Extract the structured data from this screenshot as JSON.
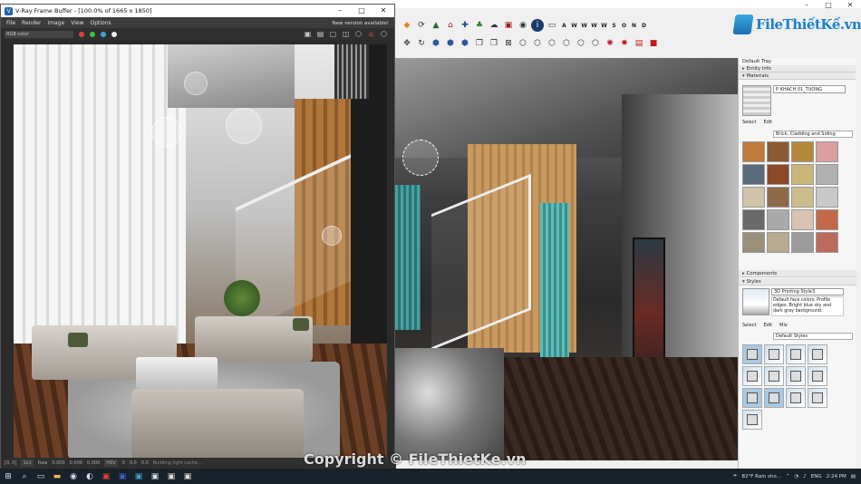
{
  "sketchup": {
    "title": "",
    "toolbar_letters": [
      "A",
      "W",
      "W",
      "W",
      "W",
      "S",
      "O",
      "N",
      "D"
    ],
    "logo_text": "FileThiếtKế.vn"
  },
  "tray": {
    "title": "Default Tray",
    "entity_info": "Entity Info",
    "materials": "Materials",
    "material_name": "P KHACH 01_TUONG",
    "select_tab": "Select",
    "edit_tab": "Edit",
    "library": "Brick, Cladding and Siding",
    "components": "Components",
    "styles": "Styles",
    "style_name": "3D Printing Style3",
    "style_desc": "Default face colors. Profile edges. Bright blue sky and dark gray background.",
    "style_select_tab": "Select",
    "style_edit_tab": "Edit",
    "style_mix_tab": "Mix",
    "style_library": "Default Styles",
    "swatch_colors": [
      "#c07a3a",
      "#8a5a32",
      "#b58a3c",
      "#d9a0a0",
      "#5a6a7a",
      "#8a4a2a",
      "#c9b77a",
      "#b0b0b0",
      "#cfc4a8",
      "#8e6a4a",
      "#cdbd8e",
      "#c8c8c8",
      "#6a6a6a",
      "#aaaaaa",
      "#d9c2b2",
      "#c2694a",
      "#9a8f7a",
      "#b7aa8e",
      "#9c9c9c",
      "#bb6b5b"
    ]
  },
  "vfb": {
    "title": "V-Ray Frame Buffer - [100.0% of 1665 x 1850]",
    "menu": [
      "File",
      "Render",
      "Image",
      "View",
      "Options"
    ],
    "new_version": "New version available!",
    "channel": "RGB color",
    "status": {
      "coords": "[0, 0]",
      "zoom": "1x1",
      "raw": "Raw",
      "v1": "0.000",
      "v2": "0.000",
      "v3": "0.000",
      "mode": "HSV",
      "v4": "0",
      "v5": "0.0",
      "v6": "0.0",
      "info": "Building light cache..."
    }
  },
  "watermark": "Copyright © FileThietKe.vn",
  "taskbar": {
    "weather": "82°F  Rain sho...",
    "lang": "ENG",
    "time": "2:24 PM"
  }
}
